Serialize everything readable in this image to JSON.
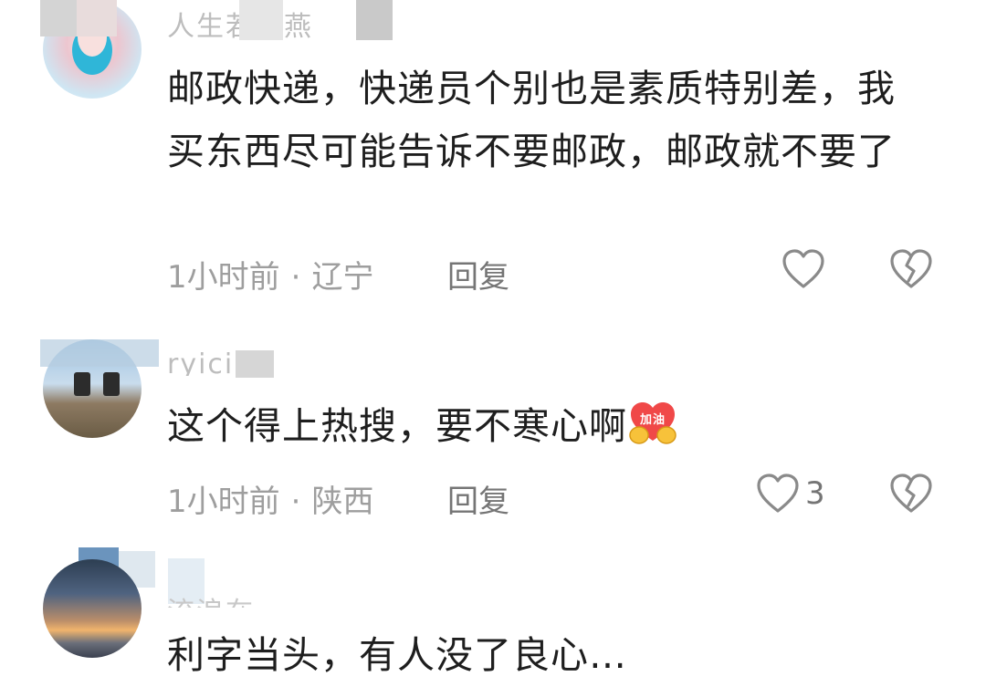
{
  "comments": [
    {
      "username": "人生若止燕",
      "content": "邮政快递，快递员个别也是素质特别差，我买东西尽可能告诉不要邮政，邮政就不要了",
      "time": "1小时前",
      "location": "辽宁",
      "reply_label": "回复",
      "likes": ""
    },
    {
      "username": "ryici",
      "content": "这个得上热搜，要不寒心啊",
      "emoji_text": "加油",
      "time": "1小时前",
      "location": "陕西",
      "reply_label": "回复",
      "likes": "3"
    },
    {
      "username": "流浪在",
      "content": "利字当头，有人没了良心…"
    }
  ],
  "separator": "·",
  "colors": {
    "text": "#1e1e1e",
    "meta": "#9e9e9e",
    "icon": "#8a8a8a",
    "emoji_red": "#f04848",
    "emoji_yellow": "#f7c23a"
  },
  "icons": {
    "like": "heart-outline-icon",
    "dislike": "broken-heart-icon",
    "emoji": "cheer-emoji-icon"
  }
}
